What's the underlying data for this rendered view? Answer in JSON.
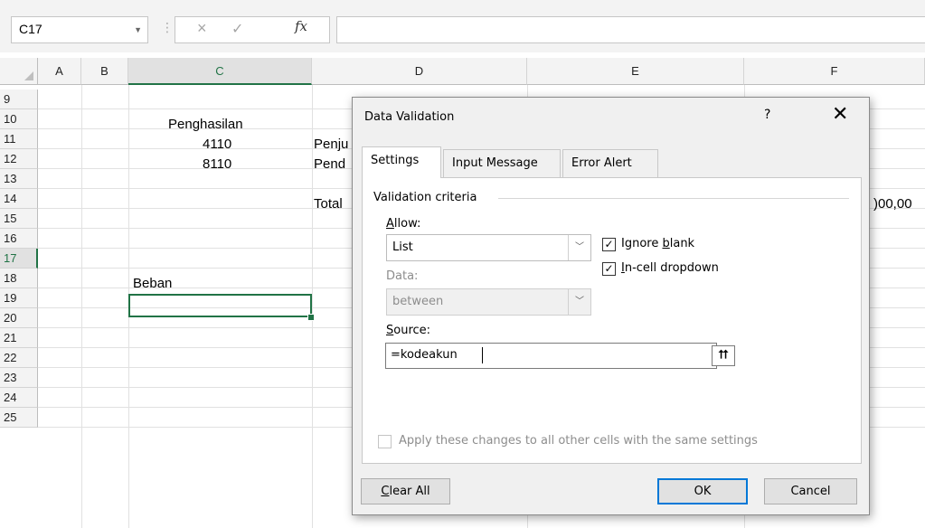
{
  "name_box": {
    "value": "C17"
  },
  "formula_bar": {
    "cancel_glyph": "×",
    "enter_glyph": "✓",
    "function_label": "fx",
    "content": ""
  },
  "columns": [
    "A",
    "B",
    "C",
    "D",
    "E",
    "F"
  ],
  "rows": [
    "9",
    "10",
    "11",
    "12",
    "13",
    "14",
    "15",
    "16",
    "17",
    "18",
    "19",
    "20",
    "21",
    "22",
    "23",
    "24",
    "25"
  ],
  "active": {
    "column": "C",
    "row": "17"
  },
  "cells": {
    "c10": "Penghasilan",
    "c11": "4110",
    "c12": "8110",
    "d11": "Penju",
    "d12": "Pend",
    "d14": "Total",
    "f14": ")00,00",
    "c16": "Beban"
  },
  "dialog": {
    "title": "Data Validation",
    "help": "?",
    "close": "✕",
    "tabs": [
      "Settings",
      "Input Message",
      "Error Alert"
    ],
    "selected_tab": "Settings",
    "section_label": "Validation criteria",
    "allow_label_pre": "",
    "allow_label_key": "A",
    "allow_label_post": "llow:",
    "allow_value": "List",
    "data_label": "Data:",
    "data_value": "between",
    "ignore_blank": {
      "pre": "Ignore ",
      "key": "b",
      "post": "lank",
      "checked": true
    },
    "in_cell_dropdown": {
      "pre": "",
      "key": "I",
      "post": "n-cell dropdown",
      "checked": true
    },
    "source_label_key": "S",
    "source_label_post": "ource:",
    "source_value": "=kodeakun",
    "apply_all_label": "Apply these changes to all other cells with the same settings",
    "apply_all_checked": false,
    "buttons": {
      "clear_key": "C",
      "clear_post": "lear All",
      "ok": "OK",
      "cancel": "Cancel"
    },
    "icons": {
      "dropdown": "chevron-down-icon",
      "collapse": "collapse-dialog-icon",
      "check": "checkmark-icon"
    }
  },
  "colors": {
    "accent": "#217346",
    "dialog_bg": "#f0f0f0",
    "ok_border": "#0078d7"
  }
}
